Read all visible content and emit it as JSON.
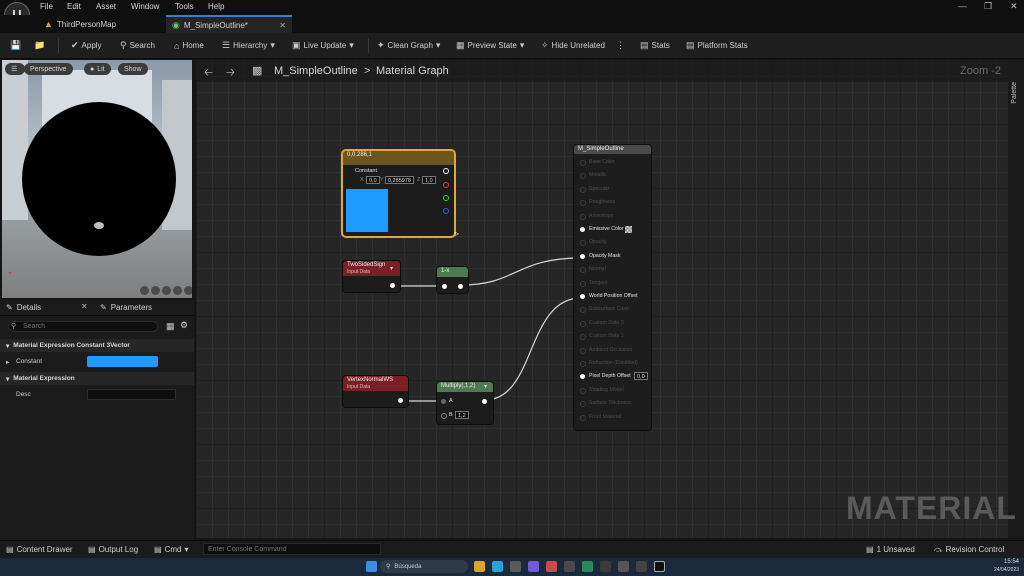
{
  "app": {
    "menu": [
      "File",
      "Edit",
      "Asset",
      "Window",
      "Tools",
      "Help"
    ],
    "tabs": [
      {
        "label": "ThirdPersonMap",
        "active": false
      },
      {
        "label": "M_SimpleOutline*",
        "active": true
      }
    ]
  },
  "toolbar": {
    "apply": "Apply",
    "search": "Search",
    "home": "Home",
    "hierarchy": "Hierarchy",
    "live_update": "Live Update",
    "clean_graph": "Clean Graph",
    "preview_state": "Preview State",
    "hide_unrelated": "Hide Unrelated",
    "stats": "Stats",
    "platform_stats": "Platform Stats"
  },
  "viewport": {
    "perspective": "Perspective",
    "lit": "Lit",
    "show": "Show"
  },
  "details": {
    "tab_details": "Details",
    "tab_parameters": "Parameters",
    "search_placeholder": "Search",
    "category_1": "Material Expression Constant 3Vector",
    "constant_label": "Constant",
    "constant_color": "#1e9bff",
    "category_2": "Material Expression",
    "desc_label": "Desc"
  },
  "graph": {
    "breadcrumb_root": "M_SimpleOutline",
    "breadcrumb_sep": ">",
    "breadcrumb_page": "Material Graph",
    "zoom": "Zoom -2",
    "palette": "Palette",
    "watermark": "MATERIAL",
    "constant_node": {
      "title": "0,0.286,1",
      "label": "Constant",
      "x_label": "X",
      "x": "0,0",
      "y_label": "Y",
      "y": "0,285978",
      "z_label": "Z",
      "z": "1,0",
      "color": "#1e9bff"
    },
    "twosided_node": {
      "title": "TwoSidedSign",
      "subtitle": "Input Data"
    },
    "multiply_small_node": {
      "title": "1-x"
    },
    "vertexnormal_node": {
      "title": "VertexNormalWS",
      "subtitle": "Input Data"
    },
    "multiply_node": {
      "title": "Multiply(,1,2)",
      "a_label": "A",
      "b_label": "B",
      "b_value": "1,2"
    },
    "result_node": {
      "title": "M_SimpleOutline",
      "inputs": [
        {
          "label": "Base Color",
          "active": false
        },
        {
          "label": "Metallic",
          "active": false
        },
        {
          "label": "Specular",
          "active": false
        },
        {
          "label": "Roughness",
          "active": false
        },
        {
          "label": "Anisotropy",
          "active": false
        },
        {
          "label": "Emissive Color",
          "active": true
        },
        {
          "label": "Opacity",
          "active": false
        },
        {
          "label": "Opacity Mask",
          "active": true
        },
        {
          "label": "Normal",
          "active": false
        },
        {
          "label": "Tangent",
          "active": false
        },
        {
          "label": "World Position Offset",
          "active": true
        },
        {
          "label": "Subsurface Color",
          "active": false
        },
        {
          "label": "Custom Data 0",
          "active": false
        },
        {
          "label": "Custom Data 1",
          "active": false
        },
        {
          "label": "Ambient Occlusion",
          "active": false
        },
        {
          "label": "Refraction (Disabled)",
          "active": false
        },
        {
          "label": "Pixel Depth Offset",
          "active": true
        },
        {
          "label": "Shading Model",
          "active": false
        },
        {
          "label": "Surface Thickness",
          "active": false
        },
        {
          "label": "Front Material",
          "active": false
        }
      ],
      "pixel_depth_value": "0,0"
    }
  },
  "bottombar": {
    "content_drawer": "Content Drawer",
    "output_log": "Output Log",
    "cmd": "Cmd",
    "console_placeholder": "Enter Console Command",
    "unsaved": "1 Unsaved",
    "revision_control": "Revision Control"
  },
  "taskbar": {
    "search": "Búsqueda",
    "time": "15:54",
    "date": "24/04/2023"
  }
}
